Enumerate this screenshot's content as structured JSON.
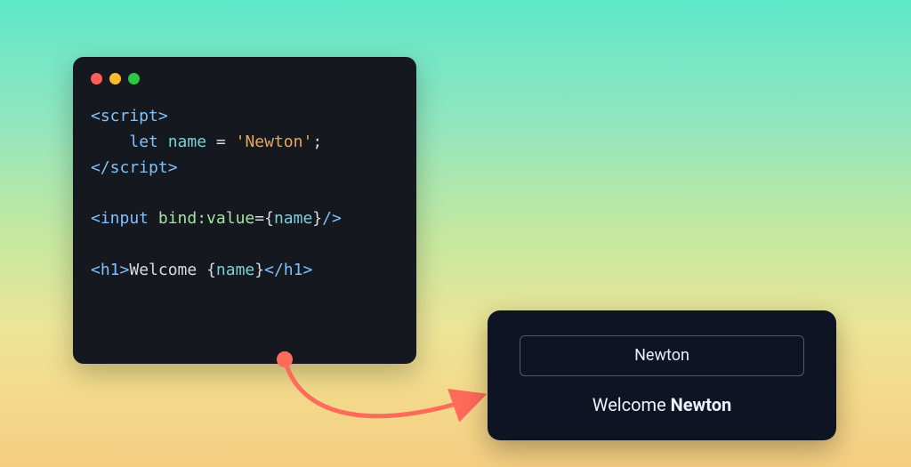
{
  "editor": {
    "lines": {
      "l1_tag_open": "<script>",
      "l2_indent": "    ",
      "l2_kw": "let",
      "l2_sp1": " ",
      "l2_ident": "name",
      "l2_sp2": " ",
      "l2_eq": "=",
      "l2_sp3": " ",
      "l2_str": "'Newton'",
      "l2_semi": ";",
      "l3_tag_close": "</script>",
      "l5_tag_open": "<input",
      "l5_sp": " ",
      "l5_attr": "bind:value",
      "l5_eq": "=",
      "l5_brace_open": "{",
      "l5_ident": "name",
      "l5_brace_close": "}",
      "l5_tag_end": "/>",
      "l7_h1_open": "<h1>",
      "l7_text": "Welcome ",
      "l7_brace_open": "{",
      "l7_ident": "name",
      "l7_brace_close": "}",
      "l7_h1_close": "</h1>"
    }
  },
  "preview": {
    "input_value": "Newton",
    "heading_prefix": "Welcome ",
    "heading_name": "Newton"
  },
  "arrow": {
    "color": "#ff6b5b"
  }
}
